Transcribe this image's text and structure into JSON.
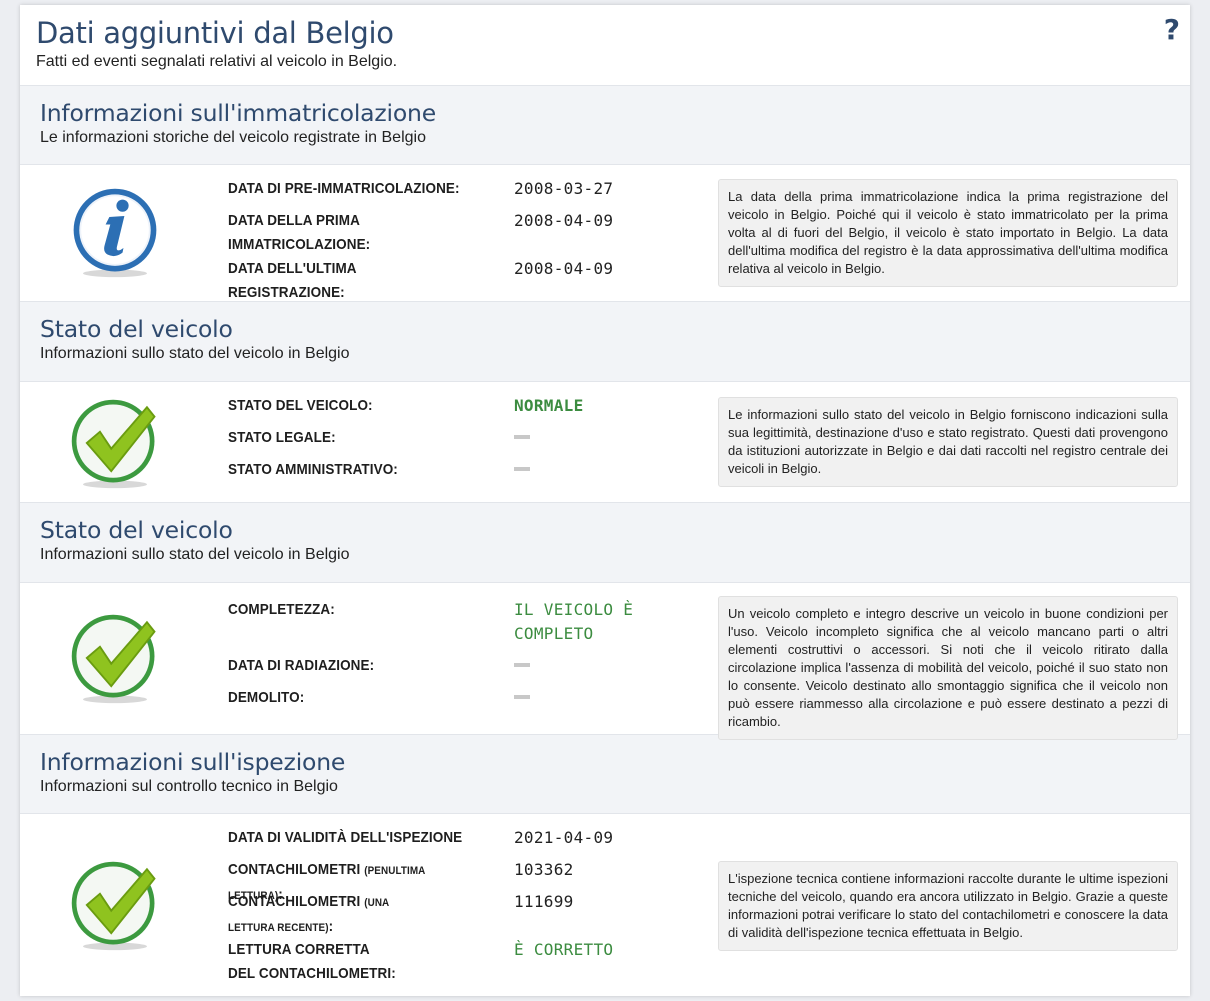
{
  "header": {
    "title": "Dati aggiuntivi dal Belgio",
    "subtitle": "Fatti ed eventi segnalati relativi al veicolo in Belgio.",
    "help_label": "?"
  },
  "sections": [
    {
      "title": "Informazioni sull'immatricolazione",
      "subtitle": "Le informazioni storiche del veicolo registrate in Belgio",
      "icon": "info-icon",
      "rows": [
        {
          "label": "DATA DI PRE-IMMATRICOLAZIONE:",
          "value": "2008-03-27"
        },
        {
          "label": "DATA DELLA PRIMA IMMATRICOLAZIONE:",
          "value": "2008-04-09"
        },
        {
          "label": "DATA DELL'ULTIMA REGISTRAZIONE:",
          "value": "2008-04-09"
        }
      ],
      "note": "La data della prima immatricolazione indica la prima registrazione del veicolo in Belgio. Poiché qui il veicolo è stato immatricolato per la prima volta al di fuori del Belgio, il veicolo è stato importato in Belgio. La data dell'ultima modifica del registro è la data approssimativa dell'ultima modifica relativa al veicolo in Belgio."
    },
    {
      "title": "Stato del veicolo",
      "subtitle": "Informazioni sullo stato del veicolo in Belgio",
      "icon": "checkmark-icon",
      "rows": [
        {
          "label": "STATO DEL VEICOLO:",
          "value": "NORMALE"
        },
        {
          "label": "STATO LEGALE:",
          "value": "—"
        },
        {
          "label": "STATO AMMINISTRATIVO:",
          "value": "—"
        }
      ],
      "note": "Le informazioni sullo stato del veicolo in Belgio forniscono indicazioni sulla sua legittimità, destinazione d'uso e stato registrato. Questi dati provengono da istituzioni autorizzate in Belgio e dai dati raccolti nel registro centrale dei veicoli in Belgio."
    },
    {
      "title": "Stato del veicolo",
      "subtitle": "Informazioni sullo stato del veicolo in Belgio",
      "icon": "checkmark-icon",
      "rows": [
        {
          "label": "COMPLETEZZA:",
          "value": "IL VEICOLO È COMPLETO"
        },
        {
          "label": "DATA DI RADIAZIONE:",
          "value": "—"
        },
        {
          "label": "DEMOLITO:",
          "value": "—"
        }
      ],
      "note": "Un veicolo completo e integro descrive un veicolo in buone condizioni per l'uso. Veicolo incompleto significa che al veicolo mancano parti o altri elementi costruttivi o accessori. Si noti che il veicolo ritirato dalla circolazione implica l'assenza di mobilità del veicolo, poiché il suo stato non lo consente. Veicolo destinato allo smontaggio significa che il veicolo non può essere riammesso alla circolazione e può essere destinato a pezzi di ricambio."
    },
    {
      "title": "Informazioni sull'ispezione",
      "subtitle": "Informazioni sul controllo tecnico in Belgio",
      "icon": "checkmark-icon",
      "rows": [
        {
          "label": "DATA DI VALIDITÀ DELL'ISPEZIONE",
          "value": "2021-04-09"
        },
        {
          "label": "CONTACHILOMETRI",
          "label_small": "(PENULTIMA LETTURA)",
          "label_suffix": ":",
          "value": "103362"
        },
        {
          "label": "CONTACHILOMETRI",
          "label_small": "(UNA LETTURA RECENTE)",
          "label_suffix": ":",
          "value": "111699"
        },
        {
          "label": "LETTURA CORRETTA DEL CONTACHILOMETRI:",
          "value": "È CORRETTO"
        }
      ],
      "note": "L'ispezione tecnica contiene informazioni raccolte durante le ultime ispezioni tecniche del veicolo, quando era ancora utilizzato in Belgio. Grazie a queste informazioni potrai verificare lo stato del contachilometri e conoscere la data di validità dell'ispezione tecnica effettuata in Belgio."
    }
  ],
  "colors": {
    "title": "#2f4a6e",
    "ok_green": "#3c8c40",
    "info_blue": "#2c6fb4"
  }
}
